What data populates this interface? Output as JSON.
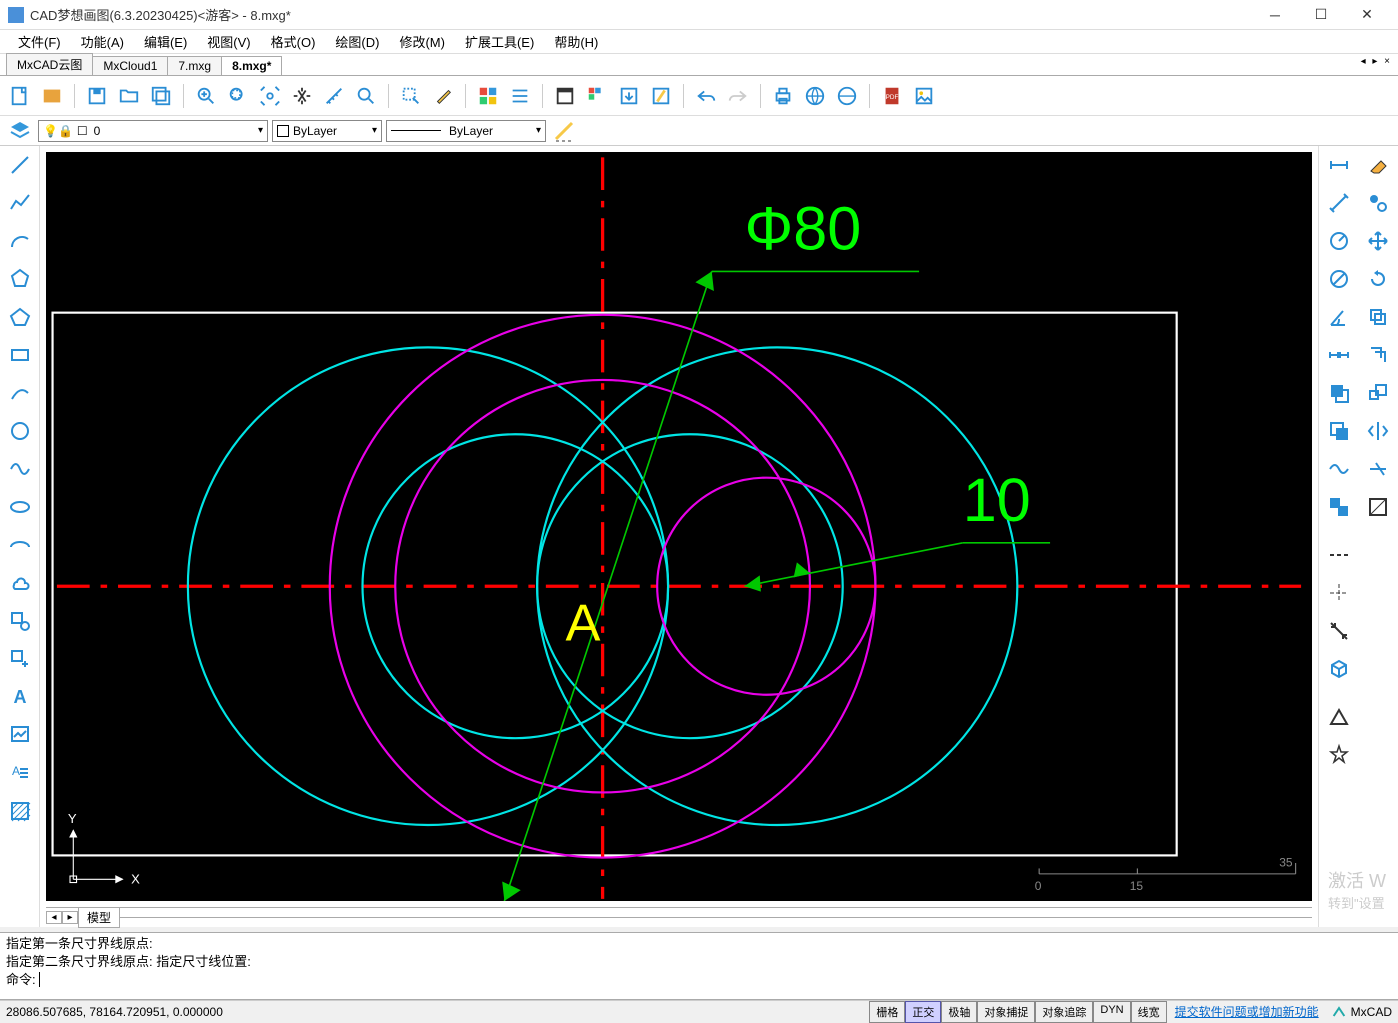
{
  "window": {
    "title": "CAD梦想画图(6.3.20230425)<游客> - 8.mxg*"
  },
  "menu": [
    "文件(F)",
    "功能(A)",
    "编辑(E)",
    "视图(V)",
    "格式(O)",
    "绘图(D)",
    "修改(M)",
    "扩展工具(E)",
    "帮助(H)"
  ],
  "tabs": {
    "items": [
      "MxCAD云图",
      "MxCloud1",
      "7.mxg",
      "8.mxg*"
    ],
    "active": 3
  },
  "layer": {
    "current": "0",
    "bylayer1": "ByLayer",
    "bylayer2": "ByLayer"
  },
  "drawing": {
    "dim1": "Φ80",
    "dim2": "10",
    "label": "A",
    "axis_x": "X",
    "axis_y": "Y",
    "scale_ticks": [
      "0",
      "15",
      "35"
    ]
  },
  "model_tab": "模型",
  "command": {
    "history": [
      "指定第一条尺寸界线原点:",
      "指定第二条尺寸界线原点:  指定尺寸线位置:"
    ],
    "prompt": "命令:"
  },
  "status": {
    "coords": "28086.507685,  78164.720951,  0.000000",
    "toggles": [
      "栅格",
      "正交",
      "极轴",
      "对象捕捉",
      "对象追踪",
      "DYN",
      "线宽"
    ],
    "active": [
      1
    ],
    "link": "提交软件问题或增加新功能",
    "brand": "MxCAD"
  },
  "watermark": {
    "line1": "激活 W",
    "line2": "转到\"设置"
  }
}
